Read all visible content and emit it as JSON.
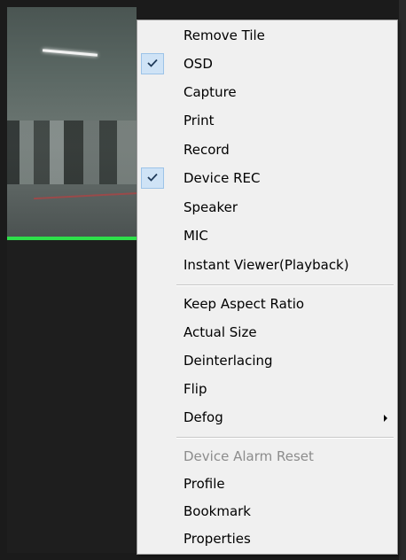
{
  "colors": {
    "menu_background": "#f0f0f0",
    "menu_border": "#979797",
    "check_highlight": "#cfe3f6",
    "disabled_text": "#8c8c8c",
    "tile_status_bar": "#2ee04a"
  },
  "context_menu": {
    "groups": [
      {
        "items": [
          {
            "label": "Remove Tile",
            "checked": false,
            "enabled": true
          },
          {
            "label": "OSD",
            "checked": true,
            "enabled": true,
            "icon": "check-icon"
          },
          {
            "label": "Capture",
            "checked": false,
            "enabled": true
          },
          {
            "label": "Print",
            "checked": false,
            "enabled": true
          },
          {
            "label": "Record",
            "checked": false,
            "enabled": true
          },
          {
            "label": "Device REC",
            "checked": true,
            "enabled": true,
            "icon": "check-icon"
          },
          {
            "label": "Speaker",
            "checked": false,
            "enabled": true
          },
          {
            "label": "MIC",
            "checked": false,
            "enabled": true
          },
          {
            "label": "Instant Viewer(Playback)",
            "checked": false,
            "enabled": true
          }
        ]
      },
      {
        "items": [
          {
            "label": "Keep Aspect Ratio",
            "checked": false,
            "enabled": true
          },
          {
            "label": "Actual Size",
            "checked": false,
            "enabled": true
          },
          {
            "label": "Deinterlacing",
            "checked": false,
            "enabled": true
          },
          {
            "label": "Flip",
            "checked": false,
            "enabled": true
          },
          {
            "label": "Defog",
            "checked": false,
            "enabled": true,
            "submenu": true,
            "submenu_icon": "chevron-right-icon"
          }
        ]
      },
      {
        "items": [
          {
            "label": "Device Alarm Reset",
            "checked": false,
            "enabled": false
          },
          {
            "label": "Profile",
            "checked": false,
            "enabled": true
          },
          {
            "label": "Bookmark",
            "checked": false,
            "enabled": true
          },
          {
            "label": "Properties",
            "checked": false,
            "enabled": true
          }
        ]
      }
    ]
  }
}
